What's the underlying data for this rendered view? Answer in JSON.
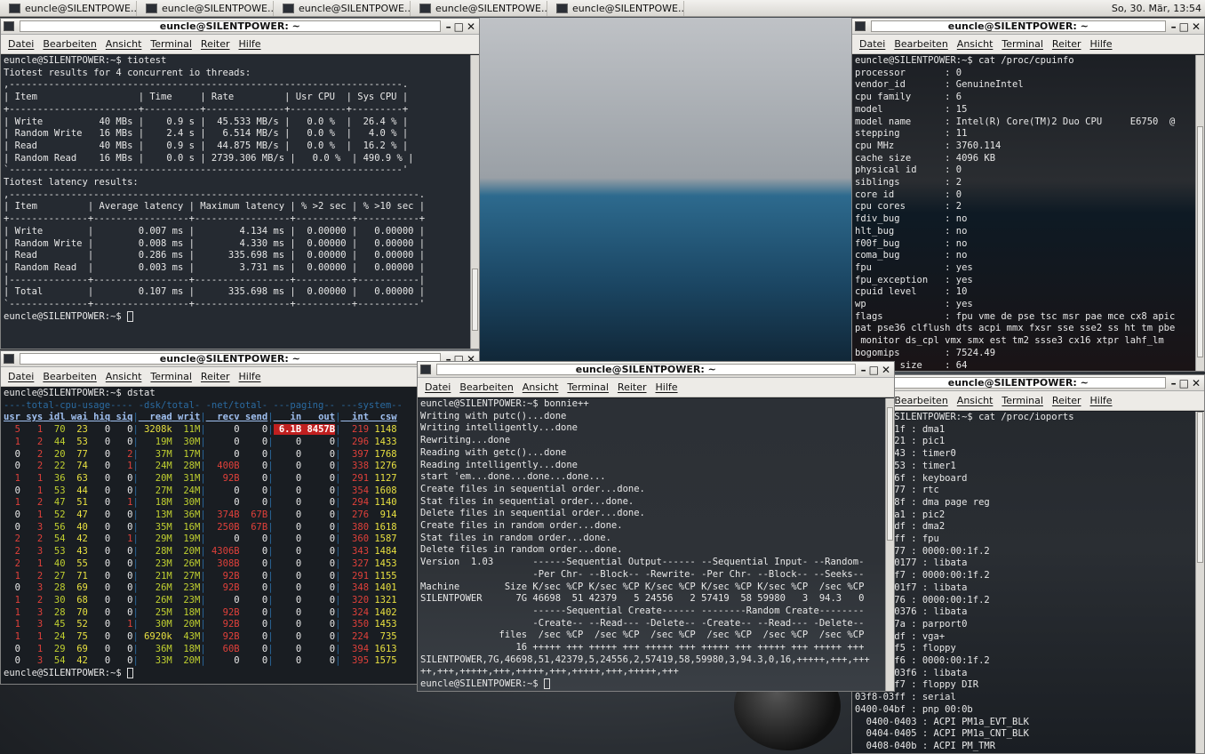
{
  "taskbar": {
    "tasks": [
      "euncle@SILENTPOWE...",
      "euncle@SILENTPOWE...",
      "euncle@SILENTPOWE...",
      "euncle@SILENTPOWE...",
      "euncle@SILENTPOWE..."
    ],
    "clock": "So, 30. Mär, 13:54"
  },
  "menu": [
    "Datei",
    "Bearbeiten",
    "Ansicht",
    "Terminal",
    "Reiter",
    "Hilfe"
  ],
  "window_title": "euncle@SILENTPOWER: ~",
  "tiotest": [
    "",
    "euncle@SILENTPOWER:~$ tiotest",
    "Tiotest results for 4 concurrent io threads:",
    ",----------------------------------------------------------------------.",
    "| Item                  | Time     | Rate         | Usr CPU  | Sys CPU |",
    "+-----------------------+----------+--------------+----------+---------+",
    "| Write          40 MBs |    0.9 s |  45.533 MB/s |   0.0 %  |  26.4 % |",
    "| Random Write   16 MBs |    2.4 s |   6.514 MB/s |   0.0 %  |   4.0 % |",
    "| Read           40 MBs |    0.9 s |  44.875 MB/s |   0.0 %  |  16.2 % |",
    "| Random Read    16 MBs |    0.0 s | 2739.306 MB/s |   0.0 %  | 490.9 % |",
    "`----------------------------------------------------------------------'",
    "Tiotest latency results:",
    ",-------------------------------------------------------------------------.",
    "| Item         | Average latency | Maximum latency | % >2 sec | % >10 sec |",
    "+--------------+-----------------+-----------------+----------+-----------+",
    "| Write        |        0.007 ms |        4.134 ms |  0.00000 |   0.00000 |",
    "| Random Write |        0.008 ms |        4.330 ms |  0.00000 |   0.00000 |",
    "| Read         |        0.286 ms |      335.698 ms |  0.00000 |   0.00000 |",
    "| Random Read  |        0.003 ms |        3.731 ms |  0.00000 |   0.00000 |",
    "|--------------+-----------------+-----------------+----------+-----------|",
    "| Total        |        0.107 ms |      335.698 ms |  0.00000 |   0.00000 |",
    "`--------------+-----------------+-----------------+----------+-----------'",
    "",
    "euncle@SILENTPOWER:~$ "
  ],
  "cpuinfo": [
    "euncle@SILENTPOWER:~$ cat /proc/cpuinfo",
    "processor       : 0",
    "vendor_id       : GenuineIntel",
    "cpu family      : 6",
    "model           : 15",
    "model name      : Intel(R) Core(TM)2 Duo CPU     E6750  @",
    "stepping        : 11",
    "cpu MHz         : 3760.114",
    "cache size      : 4096 KB",
    "physical id     : 0",
    "siblings        : 2",
    "core id         : 0",
    "cpu cores       : 2",
    "fdiv_bug        : no",
    "hlt_bug         : no",
    "f00f_bug        : no",
    "coma_bug        : no",
    "fpu             : yes",
    "fpu_exception   : yes",
    "cpuid level     : 10",
    "wp              : yes",
    "flags           : fpu vme de pse tsc msr pae mce cx8 apic",
    "pat pse36 clflush dts acpi mmx fxsr sse sse2 ss ht tm pbe",
    " monitor ds_cpl vmx smx est tm2 ssse3 cx16 xtpr lahf_lm",
    "bogomips        : 7524.49",
    "clflush size    : 64"
  ],
  "dstat": {
    "prompt": "euncle@SILENTPOWER:~$ dstat",
    "groups": "----total-cpu-usage---- -dsk/total- -net/total- ---paging-- ---system--",
    "cols": [
      "usr",
      "sys",
      "idl",
      "wai",
      "hiq",
      "siq",
      "read",
      "writ",
      "recv",
      "send",
      "in",
      "out",
      "int",
      "csw"
    ],
    "rows": [
      [
        "5",
        "1",
        "70",
        "23",
        "0",
        "0",
        "3208k",
        "11M",
        "0",
        "0",
        "6.1B",
        "8457B",
        "219",
        "1148"
      ],
      [
        "1",
        "2",
        "44",
        "53",
        "0",
        "0",
        "19M",
        "30M",
        "0",
        "0",
        "0",
        "0",
        "296",
        "1433"
      ],
      [
        "0",
        "2",
        "20",
        "77",
        "0",
        "2",
        "37M",
        "17M",
        "0",
        "0",
        "0",
        "0",
        "397",
        "1768"
      ],
      [
        "0",
        "2",
        "22",
        "74",
        "0",
        "1",
        "24M",
        "28M",
        "400B",
        "0",
        "0",
        "0",
        "338",
        "1276"
      ],
      [
        "1",
        "1",
        "36",
        "63",
        "0",
        "0",
        "20M",
        "31M",
        "92B",
        "0",
        "0",
        "0",
        "291",
        "1127"
      ],
      [
        "0",
        "1",
        "53",
        "44",
        "0",
        "0",
        "27M",
        "24M",
        "0",
        "0",
        "0",
        "0",
        "354",
        "1608"
      ],
      [
        "1",
        "2",
        "47",
        "51",
        "0",
        "1",
        "18M",
        "30M",
        "0",
        "0",
        "0",
        "0",
        "294",
        "1140"
      ],
      [
        "0",
        "1",
        "52",
        "47",
        "0",
        "0",
        "13M",
        "36M",
        "374B",
        "67B",
        "0",
        "0",
        "276",
        "914"
      ],
      [
        "0",
        "3",
        "56",
        "40",
        "0",
        "0",
        "35M",
        "16M",
        "250B",
        "67B",
        "0",
        "0",
        "380",
        "1618"
      ],
      [
        "2",
        "2",
        "54",
        "42",
        "0",
        "1",
        "29M",
        "19M",
        "0",
        "0",
        "0",
        "0",
        "360",
        "1587"
      ],
      [
        "2",
        "3",
        "53",
        "43",
        "0",
        "0",
        "28M",
        "20M",
        "4306B",
        "0",
        "0",
        "0",
        "343",
        "1484"
      ],
      [
        "2",
        "1",
        "40",
        "55",
        "0",
        "0",
        "23M",
        "26M",
        "308B",
        "0",
        "0",
        "0",
        "327",
        "1453"
      ],
      [
        "1",
        "2",
        "27",
        "71",
        "0",
        "0",
        "21M",
        "27M",
        "92B",
        "0",
        "0",
        "0",
        "291",
        "1155"
      ],
      [
        "0",
        "3",
        "28",
        "69",
        "0",
        "0",
        "26M",
        "23M",
        "92B",
        "0",
        "0",
        "0",
        "348",
        "1401"
      ],
      [
        "1",
        "2",
        "30",
        "68",
        "0",
        "0",
        "26M",
        "23M",
        "0",
        "0",
        "0",
        "0",
        "320",
        "1321"
      ],
      [
        "1",
        "3",
        "28",
        "70",
        "0",
        "0",
        "25M",
        "18M",
        "92B",
        "0",
        "0",
        "0",
        "324",
        "1402"
      ],
      [
        "1",
        "3",
        "45",
        "52",
        "0",
        "1",
        "30M",
        "20M",
        "92B",
        "0",
        "0",
        "0",
        "350",
        "1453"
      ],
      [
        "1",
        "1",
        "24",
        "75",
        "0",
        "0",
        "6920k",
        "43M",
        "92B",
        "0",
        "0",
        "0",
        "224",
        "735"
      ],
      [
        "0",
        "1",
        "29",
        "69",
        "0",
        "0",
        "36M",
        "18M",
        "60B",
        "0",
        "0",
        "0",
        "394",
        "1613"
      ],
      [
        "0",
        "3",
        "54",
        "42",
        "0",
        "0",
        "33M",
        "20M",
        "0",
        "0",
        "0",
        "0",
        "395",
        "1575"
      ]
    ],
    "end": "euncle@SILENTPOWER:~$ "
  },
  "bonnie": [
    "euncle@SILENTPOWER:~$ bonnie++",
    "Writing with putc()...done",
    "Writing intelligently...done",
    "Rewriting...done",
    "Reading with getc()...done",
    "Reading intelligently...done",
    "start 'em...done...done...done...",
    "Create files in sequential order...done.",
    "Stat files in sequential order...done.",
    "Delete files in sequential order...done.",
    "Create files in random order...done.",
    "Stat files in random order...done.",
    "Delete files in random order...done.",
    "Version  1.03       ------Sequential Output------ --Sequential Input- --Random-",
    "                    -Per Chr- --Block-- -Rewrite- -Per Chr- --Block-- --Seeks--",
    "Machine        Size K/sec %CP K/sec %CP K/sec %CP K/sec %CP K/sec %CP  /sec %CP",
    "SILENTPOWER      7G 46698  51 42379   5 24556   2 57419  58 59980   3  94.3   0",
    "                    ------Sequential Create------ --------Random Create--------",
    "                    -Create-- --Read--- -Delete-- -Create-- --Read--- -Delete--",
    "              files  /sec %CP  /sec %CP  /sec %CP  /sec %CP  /sec %CP  /sec %CP",
    "                 16 +++++ +++ +++++ +++ +++++ +++ +++++ +++ +++++ +++ +++++ +++",
    "SILENTPOWER,7G,46698,51,42379,5,24556,2,57419,58,59980,3,94.3,0,16,+++++,+++,+++",
    "++,+++,+++++,+++,+++++,+++,+++++,+++,+++++,+++",
    "euncle@SILENTPOWER:~$ "
  ],
  "ioports": [
    "euncle@SILENTPOWER:~$ cat /proc/ioports",
    "0000-001f : dma1",
    "0020-0021 : pic1",
    "0040-0043 : timer0",
    "0050-0053 : timer1",
    "0060-006f : keyboard",
    "0070-0077 : rtc",
    "0080-008f : dma page reg",
    "00a0-00a1 : pic2",
    "00c0-00df : dma2",
    "00f0-00ff : fpu",
    "0170-0177 : 0000:00:1f.2",
    "  0170-0177 : libata",
    "01f0-01f7 : 0000:00:1f.2",
    "  01f0-01f7 : libata",
    "0376-0376 : 0000:00:1f.2",
    "  0376-0376 : libata",
    "0378-037a : parport0",
    "03c0-03df : vga+",
    "03f2-03f5 : floppy",
    "03f6-03f6 : 0000:00:1f.2",
    "  03f6-03f6 : libata",
    "03f7-03f7 : floppy DIR",
    "03f8-03ff : serial",
    "0400-04bf : pnp 00:0b",
    "  0400-0403 : ACPI PM1a_EVT_BLK",
    "  0404-0405 : ACPI PM1a_CNT_BLK",
    "  0408-040b : ACPI PM_TMR"
  ]
}
